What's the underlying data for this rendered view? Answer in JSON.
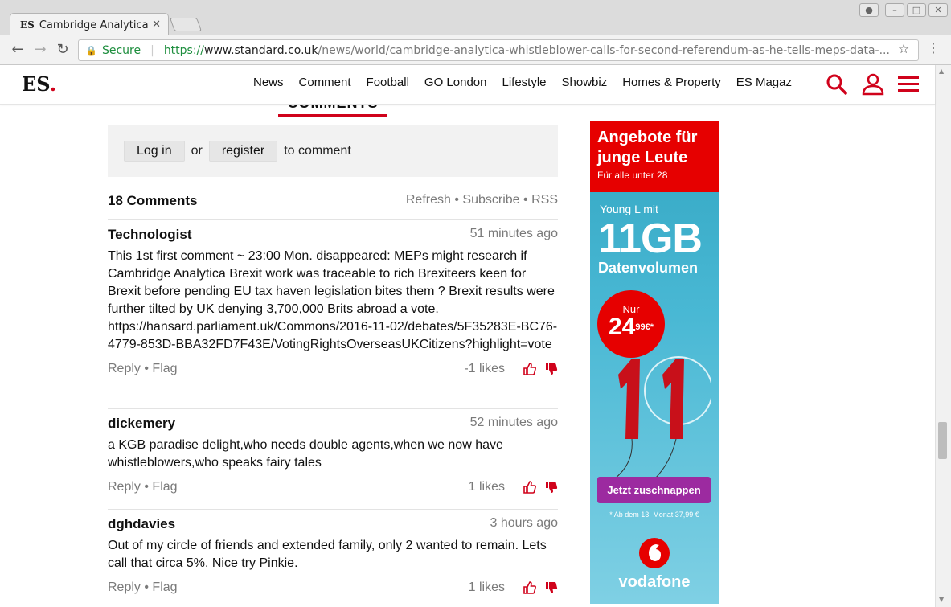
{
  "browser": {
    "tab_title": "Cambridge Analytica",
    "tab_favicon": "ES",
    "secure_label": "Secure",
    "url_scheme": "https://",
    "url_host": "www.standard.co.uk",
    "url_path": "/news/world/cambridge-analytica-whistleblower-calls-for-second-referendum-as-he-tells-meps-data-..."
  },
  "site": {
    "logo_text": "ES",
    "logo_dot": ".",
    "nav": [
      "News",
      "Comment",
      "Football",
      "GO London",
      "Lifestyle",
      "Showbiz",
      "Homes & Property",
      "ES Magaz"
    ],
    "accent_color": "#d0021b"
  },
  "comments": {
    "title": "COMMENTS",
    "login_label": "Log in",
    "or_label": "or",
    "register_label": "register",
    "to_comment_label": "to comment",
    "count_label": "18 Comments",
    "refresh_label": "Refresh",
    "subscribe_label": "Subscribe",
    "rss_label": "RSS",
    "bullet": "•",
    "items": [
      {
        "author": "Technologist",
        "time": "51 minutes ago",
        "body": "This 1st first comment ~ 23:00 Mon. disappeared: MEPs might research if Cambridge Analytica Brexit work was traceable to rich Brexiteers keen for Brexit before pending EU tax haven legislation bites them ? Brexit results were further tilted by UK denying 3,700,000 Brits abroad a vote. https://hansard.parliament.uk/Commons/2016-11-02/debates/5F35283E-BC76-4779-853D-BBA32FD7F43E/VotingRightsOverseasUKCitizens?highlight=vote",
        "reply": "Reply",
        "flag": "Flag",
        "likes": "-1 likes"
      },
      {
        "author": "dickemery",
        "time": "52 minutes ago",
        "body": "a KGB paradise delight,who needs double agents,when we now have whistleblowers,who speaks fairy tales",
        "reply": "Reply",
        "flag": "Flag",
        "likes": "1 likes"
      },
      {
        "author": "dghdavies",
        "time": "3 hours ago",
        "body": "Out of my circle of friends and extended family, only 2 wanted to remain. Lets call that circa 5%. Nice try Pinkie.",
        "reply": "Reply",
        "flag": "Flag",
        "likes": "1 likes"
      }
    ]
  },
  "ad": {
    "headline": "Angebote für junge Leute",
    "subline": "Für alle unter 28",
    "young": "Young L mit",
    "gb": "11GB",
    "volume": "Datenvolumen",
    "nur": "Nur",
    "price": "24",
    "cents": "99",
    "currency": "€*",
    "cta": "Jetzt zuschnappen",
    "footnote": "* Ab dem 13. Monat 37,99 €",
    "brand": "vodafone"
  }
}
